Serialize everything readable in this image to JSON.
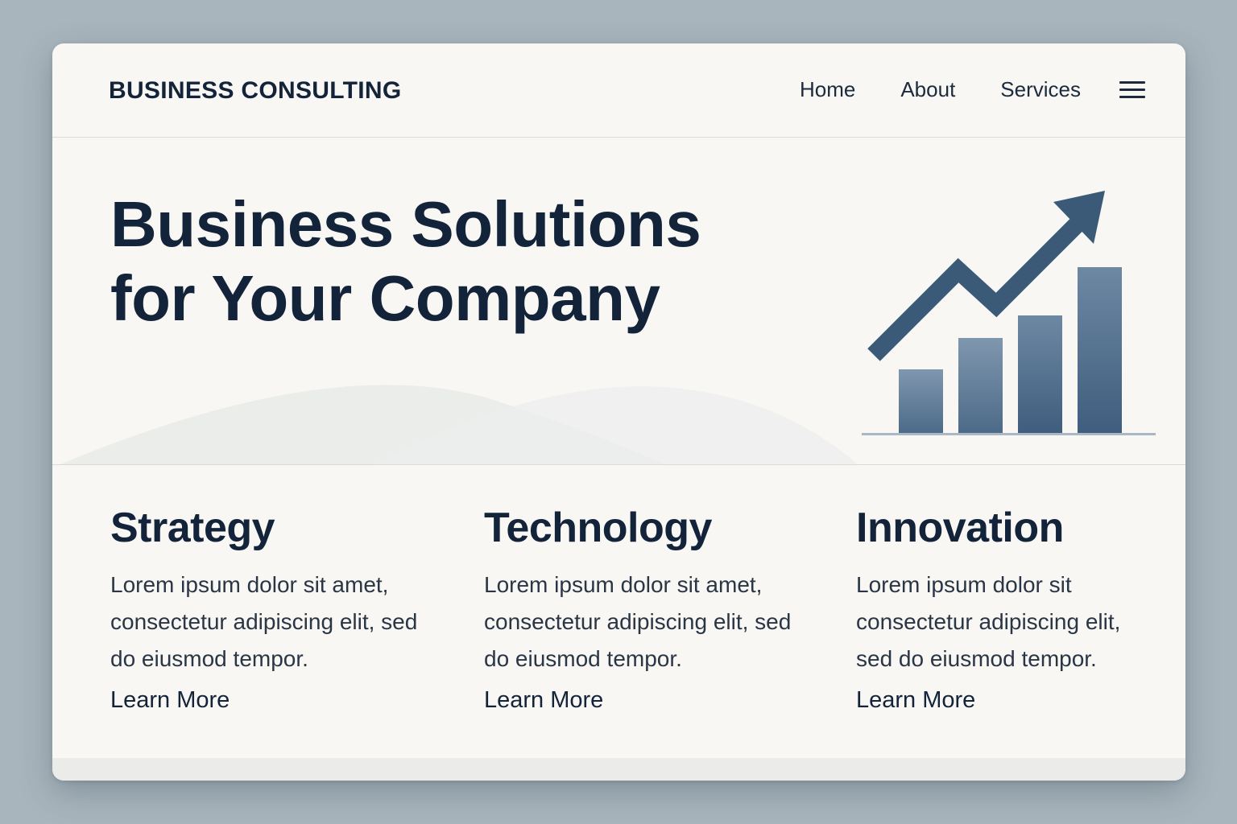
{
  "header": {
    "brand": "BUSINESS CONSULTING",
    "nav": [
      "Home",
      "About",
      "Services"
    ],
    "menu_icon": "hamburger-menu-icon"
  },
  "hero": {
    "title_line1": "Business Solutions",
    "title_line2": "for Your Company",
    "illustration": "growth-chart-icon"
  },
  "features": [
    {
      "title": "Strategy",
      "text": "Lorem ipsum dolor sit amet, consectetur adipiscing elit, sed do eiusmod tempor.",
      "link": "Learn More"
    },
    {
      "title": "Technology",
      "text": "Lorem ipsum dolor sit amet, consectetur adipiscing elit, sed do eiusmod tempor.",
      "link": "Learn More"
    },
    {
      "title": "Innovation",
      "text": "Lorem ipsum dolor sit consectetur adipiscing elit, sed do eiusmod tempor.",
      "link": "Learn More"
    }
  ],
  "colors": {
    "page_bg": "#a8b5bd",
    "card_bg": "#f8f7f3",
    "text_dark": "#13233a",
    "accent": "#3b5a78"
  }
}
